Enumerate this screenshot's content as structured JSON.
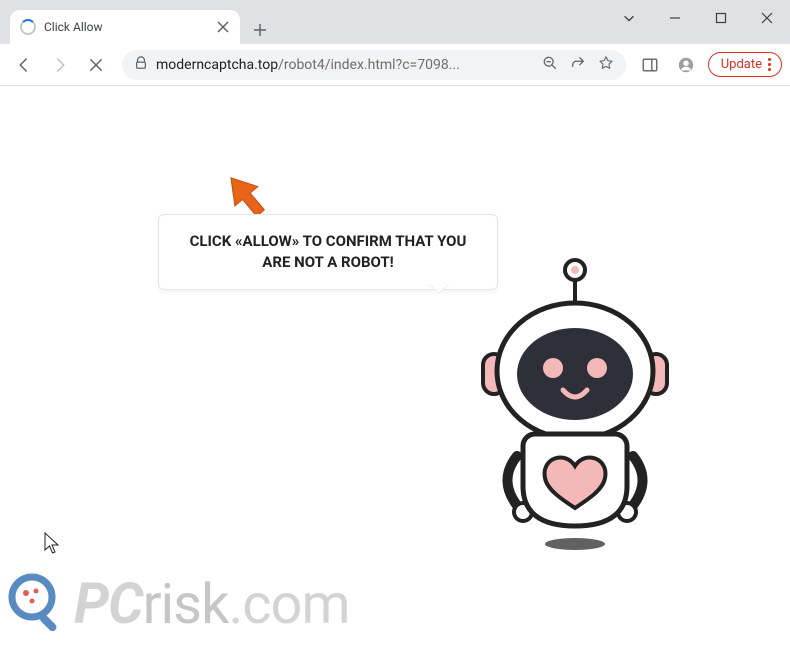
{
  "window": {
    "tab_title": "Click Allow"
  },
  "toolbar": {
    "url_domain": "moderncaptcha.top",
    "url_path": "/robot4/index.html?c=7098...",
    "update_label": "Update"
  },
  "page": {
    "speech_text": "CLICK «ALLOW» TO CONFIRM THAT YOU ARE NOT A ROBOT!"
  },
  "watermark": {
    "pc": "PC",
    "risk": "risk",
    "com": ".com"
  }
}
